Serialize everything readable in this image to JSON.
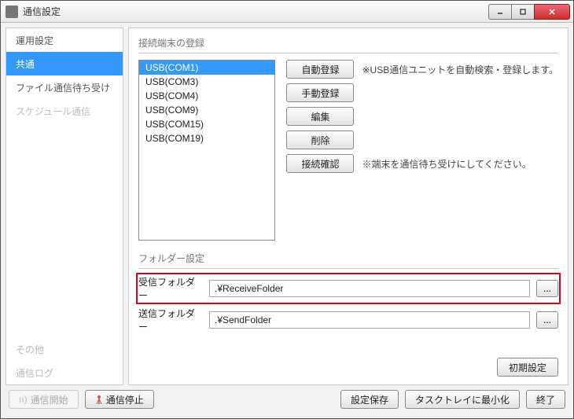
{
  "window": {
    "title": "通信設定"
  },
  "sidebar": {
    "items": [
      {
        "label": "運用設定",
        "state": "normal"
      },
      {
        "label": "共通",
        "state": "selected"
      },
      {
        "label": "ファイル通信待ち受け",
        "state": "normal"
      },
      {
        "label": "スケジュール通信",
        "state": "disabled"
      }
    ],
    "bottomItems": [
      {
        "label": "その他",
        "state": "disabled"
      },
      {
        "label": "通信ログ",
        "state": "disabled"
      }
    ]
  },
  "terminals": {
    "groupTitle": "接続端末の登録",
    "list": [
      "USB(COM1)",
      "USB(COM3)",
      "USB(COM4)",
      "USB(COM9)",
      "USB(COM15)",
      "USB(COM19)"
    ],
    "selectedIndex": 0,
    "buttons": {
      "auto": {
        "label": "自動登録",
        "note": "※USB通信ユニットを自動検索・登録します。"
      },
      "manual": {
        "label": "手動登録"
      },
      "edit": {
        "label": "編集"
      },
      "delete": {
        "label": "削除"
      },
      "check": {
        "label": "接続確認",
        "note": "※端末を通信待ち受けにしてください。"
      }
    }
  },
  "folders": {
    "groupTitle": "フォルダー設定",
    "receive": {
      "label": "受信フォルダー",
      "value": ".¥ReceiveFolder"
    },
    "send": {
      "label": "送信フォルダー",
      "value": ".¥SendFolder"
    },
    "browse": "..."
  },
  "contentFooter": {
    "reset": "初期設定"
  },
  "footer": {
    "start": "通信開始",
    "stop": "通信停止",
    "save": "設定保存",
    "tray": "タスクトレイに最小化",
    "exit": "終了"
  }
}
